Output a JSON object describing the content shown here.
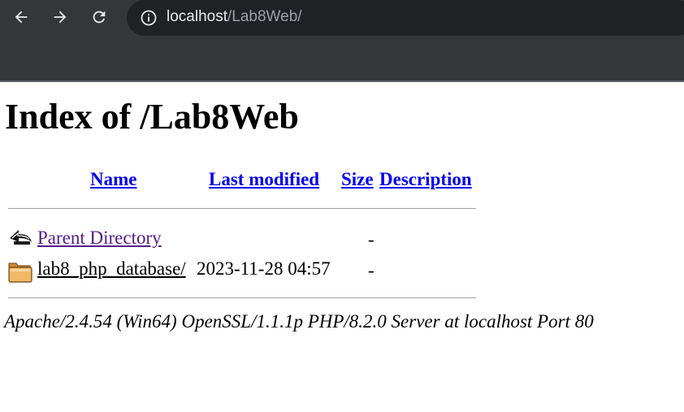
{
  "browser": {
    "url_host": "localhost",
    "url_path": "/Lab8Web/"
  },
  "page": {
    "title": "Index of /Lab8Web",
    "columns": {
      "name": "Name",
      "last_modified": "Last modified",
      "size": "Size",
      "description": "Description"
    },
    "rows": [
      {
        "name": "Parent Directory",
        "icon": "back-arrow-icon",
        "last_modified": "",
        "size": "-",
        "description": ""
      },
      {
        "name": "lab8_php_database/",
        "icon": "folder-icon",
        "last_modified": "2023-11-28 04:57",
        "size": "-",
        "description": ""
      }
    ],
    "footer": "Apache/2.4.54 (Win64) OpenSSL/1.1.1p PHP/8.2.0 Server at localhost Port 80"
  }
}
